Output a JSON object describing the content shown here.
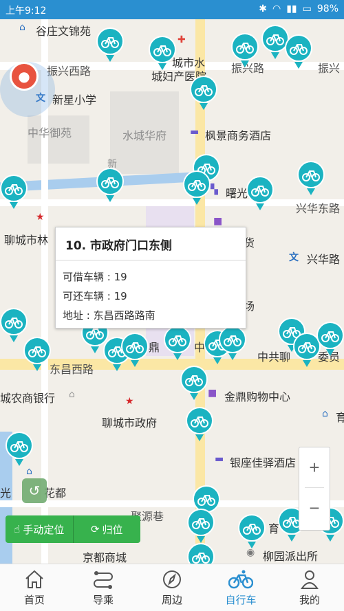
{
  "status_bar": {
    "time": "上午9:12",
    "battery": "98%"
  },
  "map": {
    "labels": [
      "谷庄文锦苑",
      "振兴西路",
      "城市水",
      "城妇产医院",
      "振兴路",
      "振兴",
      "新星小学",
      "中华御苑",
      "水城华府",
      "枫景商务酒店",
      "新",
      "曙光",
      "兴华东路",
      "聊城市林",
      "货",
      "兴华路",
      "场",
      "东昌西路",
      "鼎",
      "中",
      "中共聊",
      "委员",
      "城农商银行",
      "金鼎购物中心",
      "聊城市政府",
      "育",
      "银座佳驿酒店",
      "光",
      "花都",
      "聚源巷",
      "育",
      "京都商城",
      "柳园派出所"
    ]
  },
  "info_popup": {
    "title": "10. 市政府门口东侧",
    "borrowable": "可借车辆 : 19",
    "returnable": "可还车辆 : 19",
    "address": "地址 : 东昌西路路南"
  },
  "controls": {
    "zoom_in": "+",
    "zoom_out": "−",
    "manual_locate": "手动定位",
    "reset": "归位"
  },
  "tabs": [
    {
      "label": "首页",
      "icon": "home-icon"
    },
    {
      "label": "导乘",
      "icon": "route-icon"
    },
    {
      "label": "周边",
      "icon": "compass-icon"
    },
    {
      "label": "自行车",
      "icon": "bicycle-icon",
      "active": true
    },
    {
      "label": "我的",
      "icon": "user-icon"
    }
  ],
  "colors": {
    "accent": "#2a8fd0",
    "bike_pin": "#1bb3c1",
    "button_green": "#37b24d",
    "location_pin": "#e8533f"
  }
}
